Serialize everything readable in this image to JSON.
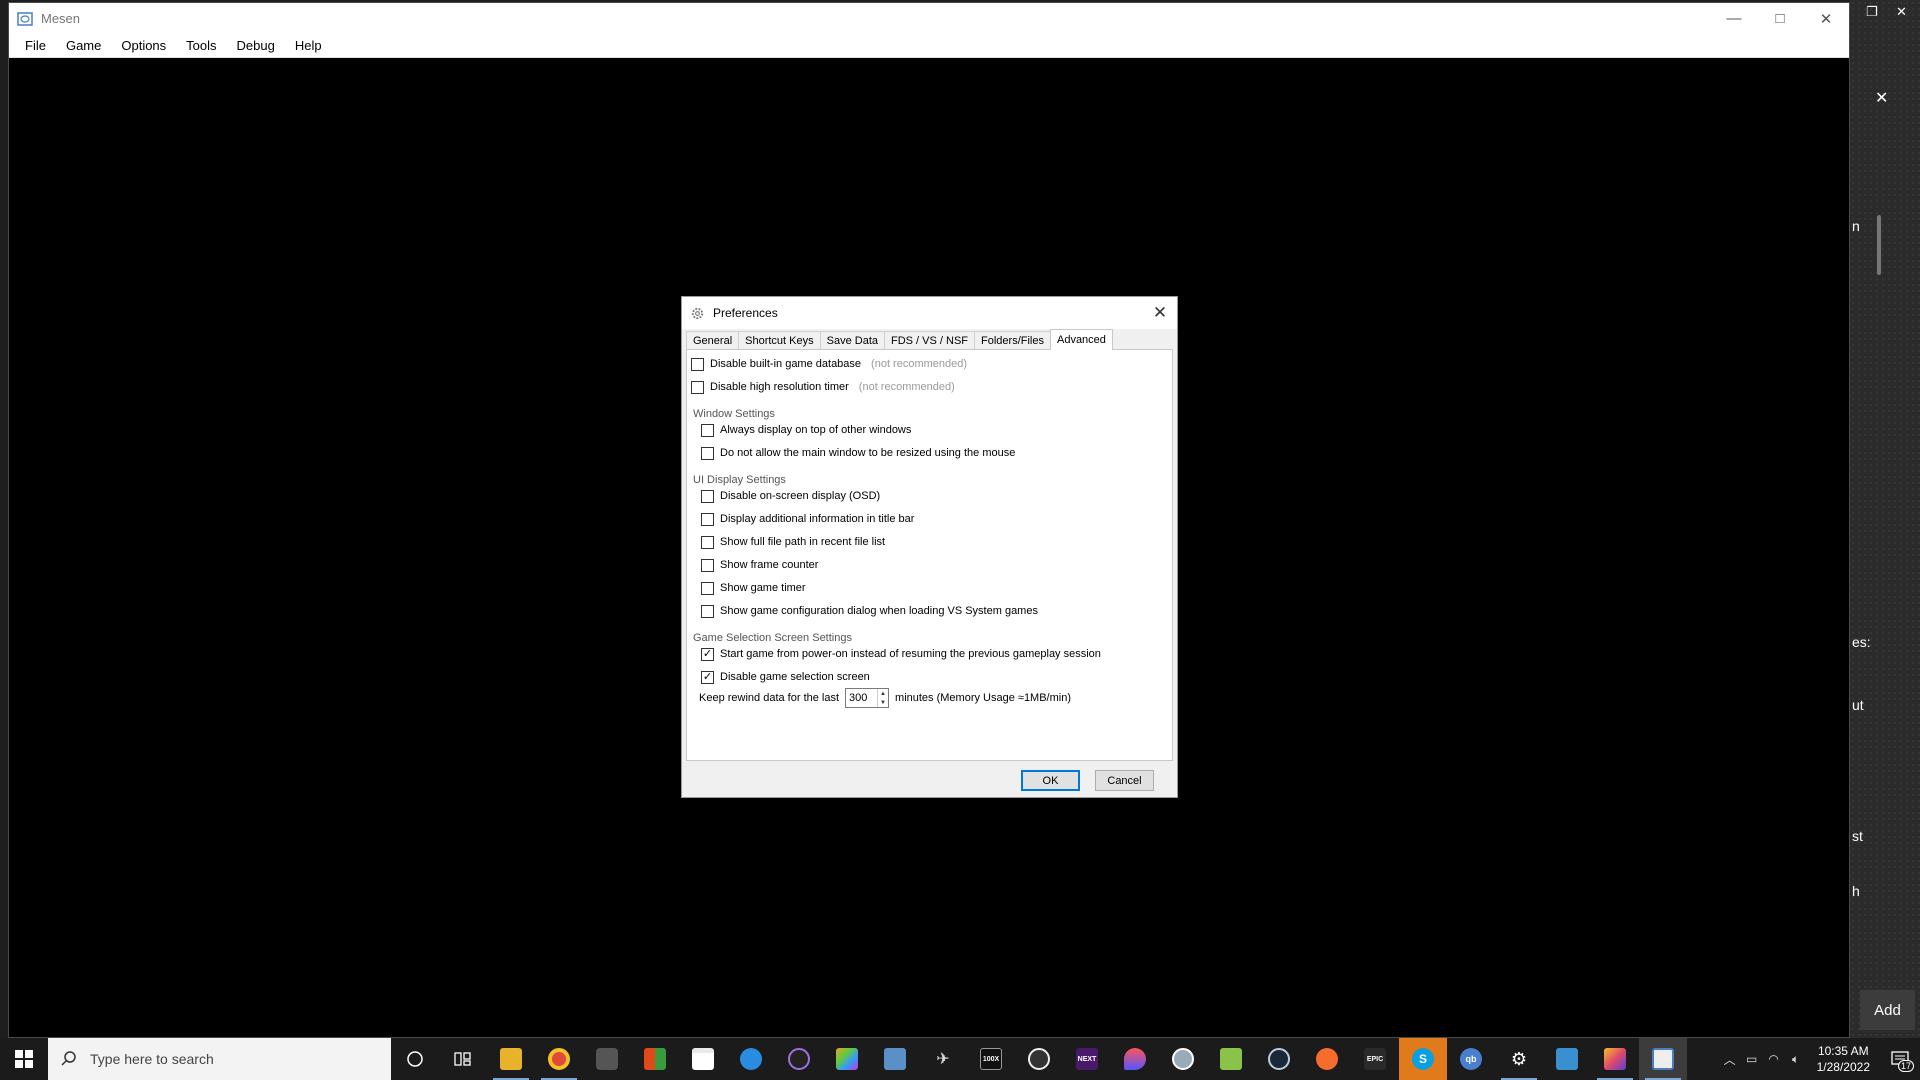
{
  "window": {
    "title": "Mesen",
    "menu": [
      "File",
      "Game",
      "Options",
      "Tools",
      "Debug",
      "Help"
    ]
  },
  "dialog": {
    "title": "Preferences",
    "tabs": [
      "General",
      "Shortcut Keys",
      "Save Data",
      "FDS / VS / NSF",
      "Folders/Files",
      "Advanced"
    ],
    "active_tab": "Advanced",
    "top_options": [
      {
        "label": "Disable built-in game database",
        "note": "(not recommended)",
        "checked": false
      },
      {
        "label": "Disable high resolution timer",
        "note": "(not recommended)",
        "checked": false
      }
    ],
    "window_settings": {
      "label": "Window Settings",
      "options": [
        {
          "label": "Always display on top of other windows",
          "checked": false
        },
        {
          "label": "Do not allow the main window to be resized using the mouse",
          "checked": false
        }
      ]
    },
    "ui_display": {
      "label": "UI Display Settings",
      "options": [
        {
          "label": "Disable on-screen display (OSD)",
          "checked": false
        },
        {
          "label": "Display additional information in title bar",
          "checked": false
        },
        {
          "label": "Show full file path in recent file list",
          "checked": false
        },
        {
          "label": "Show frame counter",
          "checked": false
        },
        {
          "label": "Show game timer",
          "checked": false
        },
        {
          "label": "Show game configuration dialog when loading VS System games",
          "checked": false
        }
      ]
    },
    "game_selection": {
      "label": "Game Selection Screen Settings",
      "options": [
        {
          "label": "Start game from power-on instead of resuming the previous gameplay session",
          "checked": true
        },
        {
          "label": "Disable game selection screen",
          "checked": true
        }
      ]
    },
    "rewind": {
      "prefix": "Keep rewind data for the last",
      "value": "300",
      "suffix": "minutes (Memory Usage ≈1MB/min)"
    },
    "ok_label": "OK",
    "cancel_label": "Cancel"
  },
  "side_panel": {
    "fragments": [
      "n",
      "es:",
      "ut",
      "st",
      "h"
    ],
    "add_label": "Add"
  },
  "taskbar": {
    "search_placeholder": "Type here to search",
    "time": "10:35 AM",
    "date": "1/28/2022",
    "notification_count": "17"
  }
}
